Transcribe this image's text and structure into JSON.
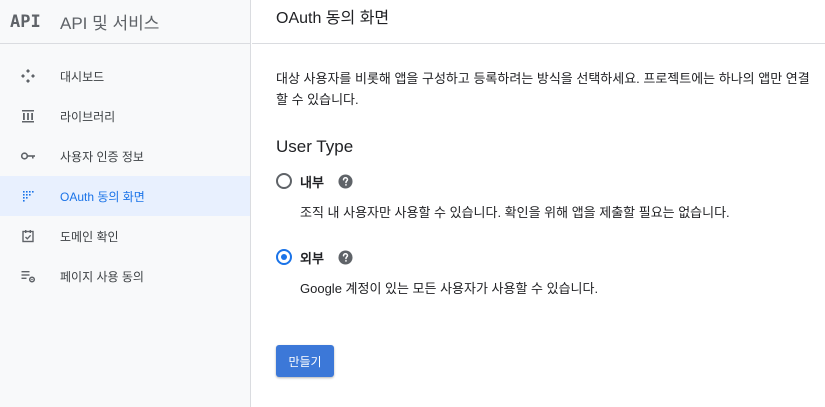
{
  "brand": {
    "logo": "API",
    "title": "API 및 서비스"
  },
  "sidebar": {
    "items": [
      {
        "label": "대시보드",
        "icon": "dashboard-icon"
      },
      {
        "label": "라이브러리",
        "icon": "library-icon"
      },
      {
        "label": "사용자 인증 정보",
        "icon": "key-icon"
      },
      {
        "label": "OAuth 동의 화면",
        "icon": "oauth-consent-icon",
        "active": true
      },
      {
        "label": "도메인 확인",
        "icon": "domain-check-icon"
      },
      {
        "label": "페이지 사용 동의",
        "icon": "page-usage-settings-icon"
      }
    ]
  },
  "main": {
    "title": "OAuth 동의 화면",
    "description": "대상 사용자를 비롯해 앱을 구성하고 등록하려는 방식을 선택하세요. 프로젝트에는 하나의 앱만 연결할 수 있습니다.",
    "user_type": {
      "title": "User Type",
      "options": [
        {
          "label": "내부",
          "description": "조직 내 사용자만 사용할 수 있습니다. 확인을 위해 앱을 제출할 필요는 없습니다.",
          "selected": false
        },
        {
          "label": "외부",
          "description": "Google 계정이 있는 모든 사용자가 사용할 수 있습니다.",
          "selected": true
        }
      ]
    },
    "create_button": "만들기"
  },
  "colors": {
    "accent": "#1a73e8",
    "button": "#3c78d8",
    "active_bg": "#e8f0fe",
    "sidebar_bg": "#f8f9fa"
  }
}
